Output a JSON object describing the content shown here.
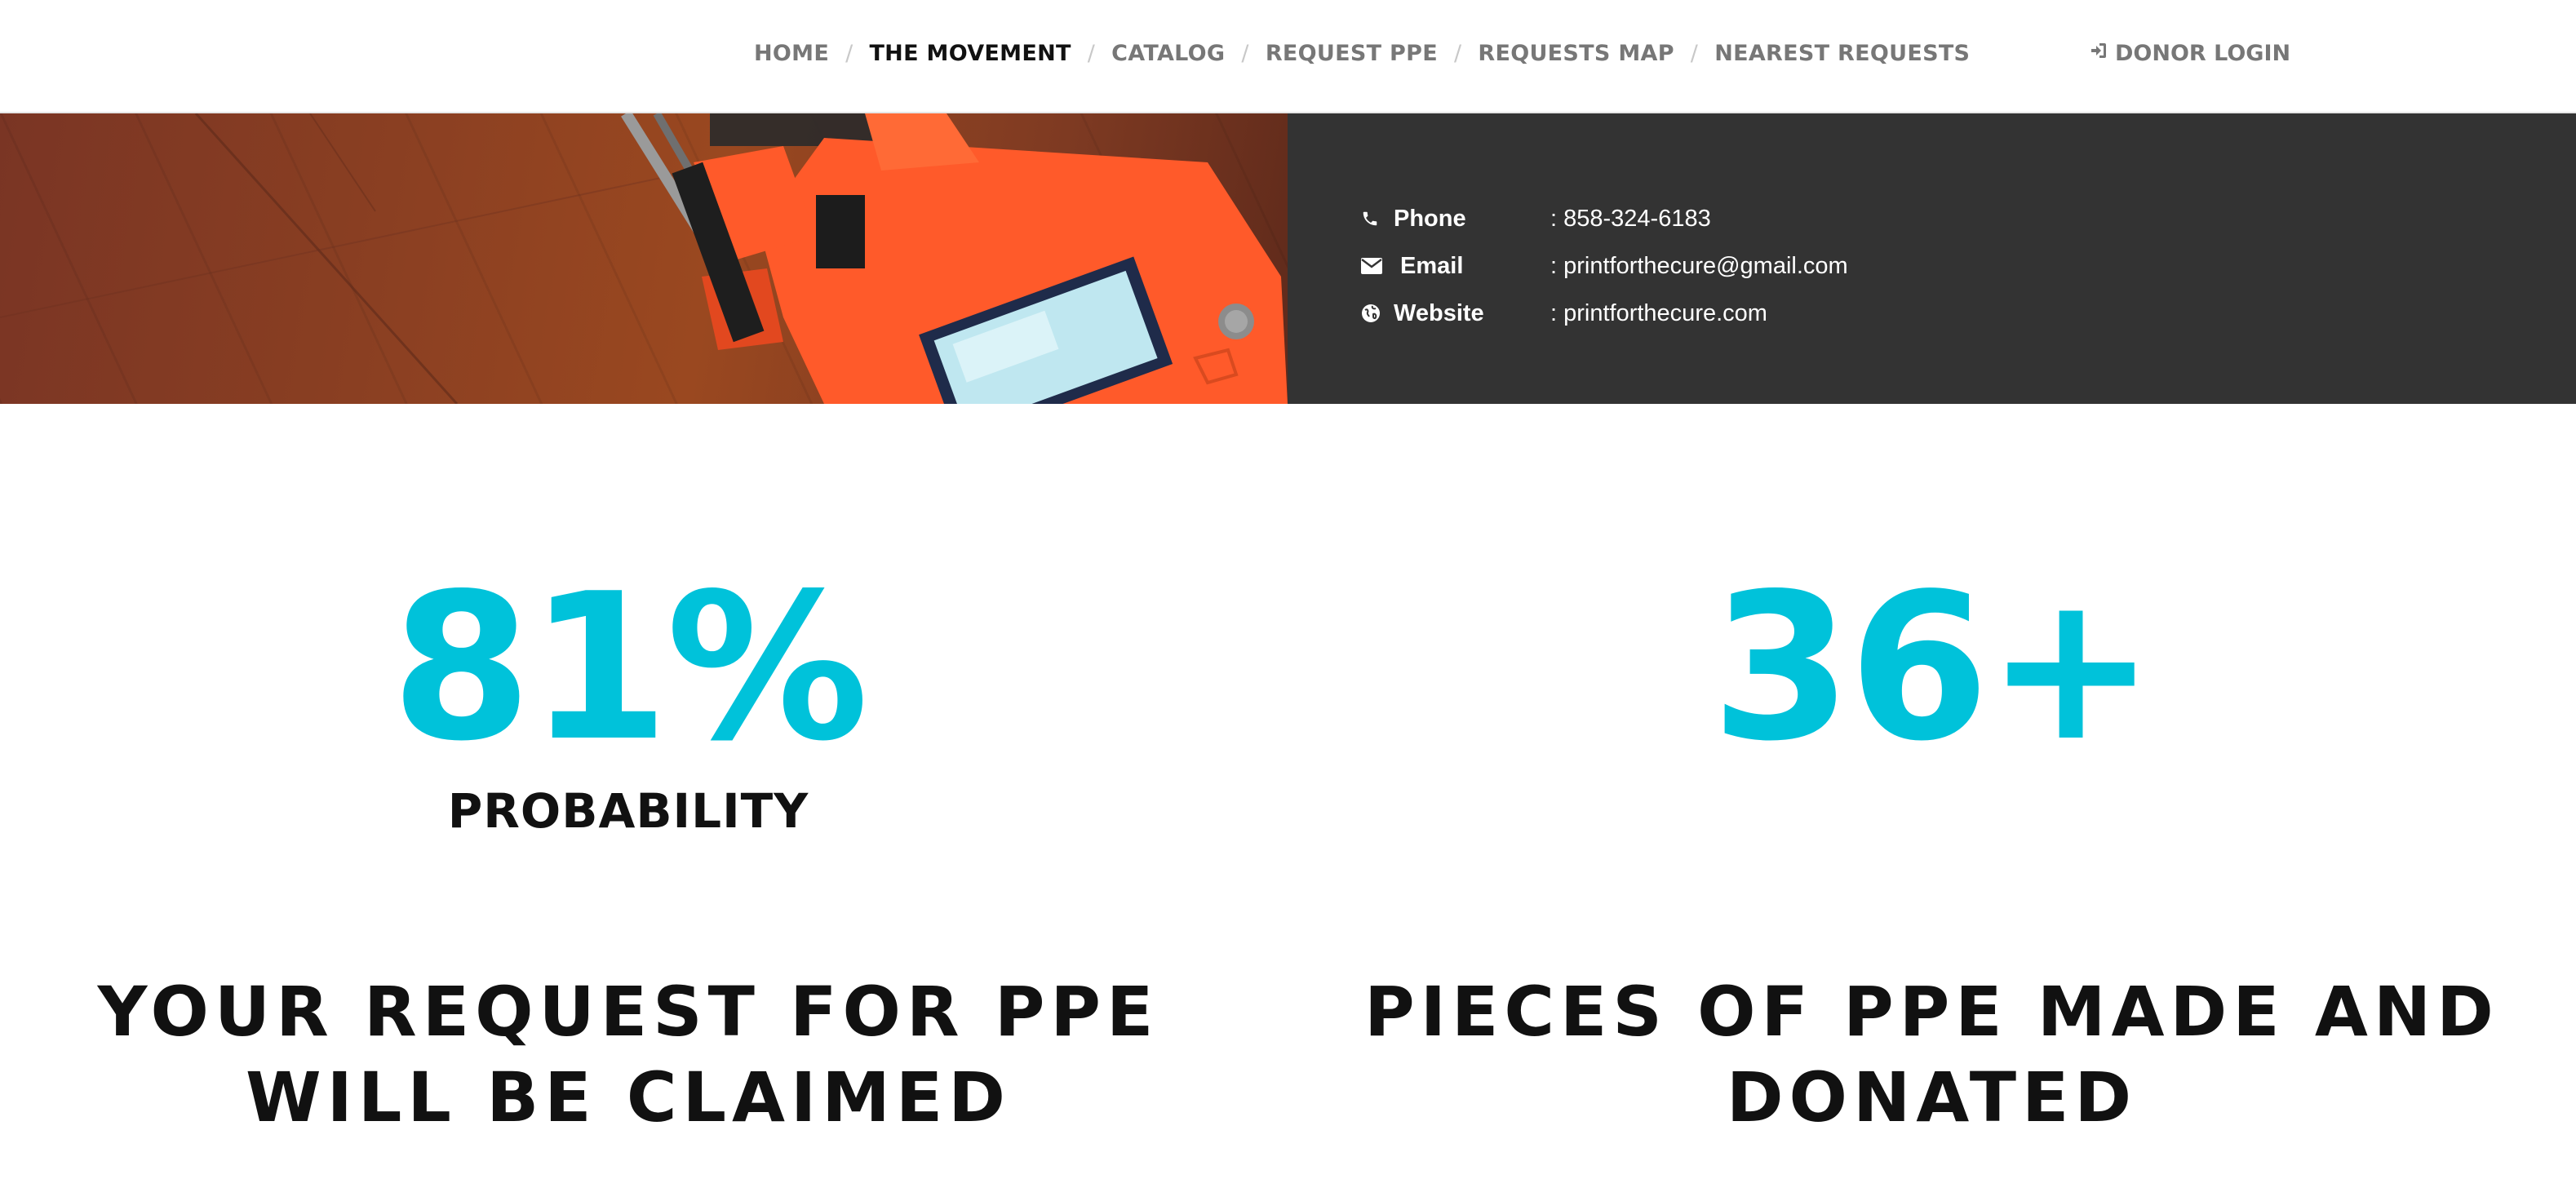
{
  "nav": {
    "items": [
      {
        "label": "HOME",
        "active": false
      },
      {
        "label": "THE MOVEMENT",
        "active": true
      },
      {
        "label": "CATALOG",
        "active": false
      },
      {
        "label": "REQUEST PPE",
        "active": false
      },
      {
        "label": "REQUESTS MAP",
        "active": false
      },
      {
        "label": "NEAREST REQUESTS",
        "active": false
      }
    ],
    "separator": "/",
    "donor_login": "DONOR LOGIN",
    "donor_login_icon": "sign-in-icon"
  },
  "contact": {
    "rows": [
      {
        "icon": "phone-icon",
        "label": "Phone",
        "value": ": 858-324-6183"
      },
      {
        "icon": "envelope-icon",
        "label": "Email",
        "value": ": printforthecure@gmail.com"
      },
      {
        "icon": "globe-icon",
        "label": "Website",
        "value": ": printforthecure.com"
      }
    ]
  },
  "stats": {
    "left": {
      "number": "81%",
      "sublabel": "PROBABILITY",
      "caption_line1": "YOUR REQUEST FOR PPE",
      "caption_line2": "WILL BE CLAIMED"
    },
    "right": {
      "number": "36+",
      "caption_line1": "PIECES OF PPE MADE AND",
      "caption_line2": "DONATED"
    }
  },
  "colors": {
    "accent": "#00c2da",
    "dark_panel": "#333333",
    "nav_text": "#777777",
    "nav_active": "#111111",
    "printer_orange": "#ff5a2a"
  }
}
